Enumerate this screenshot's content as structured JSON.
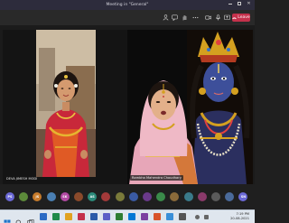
{
  "window": {
    "title": "Meeting in \"General\""
  },
  "toolbar": {
    "elapsed": "",
    "leave_label": "Leave",
    "icons": [
      "people-icon",
      "chat-icon",
      "raise-hand-icon",
      "reactions-icon",
      "more-icon",
      "camera-icon",
      "mic-icon",
      "share-icon"
    ]
  },
  "stage": {
    "left_participant": {
      "name": "DEVA JIMESH MODI"
    },
    "right_participant": {
      "name": "Rambha Mahendra Choudhary"
    }
  },
  "participants": [
    {
      "initials": "PS",
      "color": "#6b69d6"
    },
    {
      "initials": "",
      "color": "#5c8a3a"
    },
    {
      "initials": "JS",
      "color": "#c77b2b"
    },
    {
      "initials": "",
      "color": "#4a7fb3"
    },
    {
      "initials": "SK",
      "color": "#b24aa3"
    },
    {
      "initials": "",
      "color": "#8a4a2b"
    },
    {
      "initials": "AS",
      "color": "#2b8a7a"
    },
    {
      "initials": "",
      "color": "#a33a3a"
    },
    {
      "initials": "",
      "color": "#7a7a3a"
    },
    {
      "initials": "",
      "color": "#3a5aa3"
    },
    {
      "initials": "",
      "color": "#6a3a8a"
    },
    {
      "initials": "",
      "color": "#3a8a4a"
    },
    {
      "initials": "",
      "color": "#8a6a3a"
    },
    {
      "initials": "",
      "color": "#3a7a8a"
    },
    {
      "initials": "",
      "color": "#8a3a6a"
    },
    {
      "initials": "",
      "color": "#5a5a5a"
    },
    {
      "initials": "",
      "color": "#4a6a9a"
    },
    {
      "initials": "SN",
      "color": "#6b69d6"
    }
  ],
  "taskbar": {
    "time": "7:19 PM",
    "date": "20-08-2021"
  }
}
